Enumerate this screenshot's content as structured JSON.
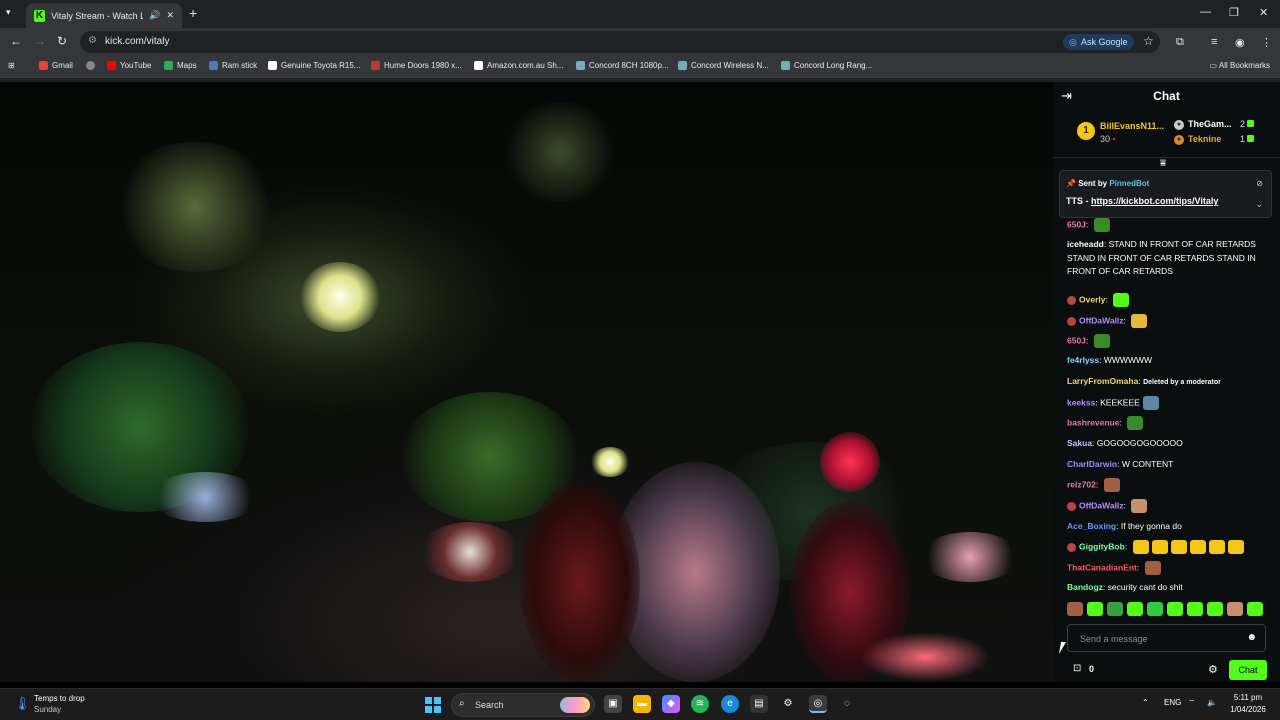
{
  "browser": {
    "tab_title": "Vitaly Stream - Watch Live",
    "url": "kick.com/vitaly",
    "ask_google": "Ask Google",
    "bookmarks": [
      "Gmail",
      "YouTube",
      "Maps",
      "Ram stick",
      "Genuine Toyota R15...",
      "Hume Doors 1980 x...",
      "Amazon.com.au Sh...",
      "Concord 8CH 1080p...",
      "Concord Wireless N...",
      "Concord Long Rang..."
    ],
    "all_bookmarks": "All Bookmarks"
  },
  "chat": {
    "title": "Chat",
    "leaderboard": {
      "first": {
        "rank": "1",
        "user": "BillEvansN11...",
        "count": "30"
      },
      "second": {
        "user": "TheGam...",
        "count": "2"
      },
      "third": {
        "user": "Teknine",
        "count": "1"
      }
    },
    "pinned": {
      "sent_by": "Sent by",
      "bot": "PinnedBot",
      "tts_prefix": "TTS - ",
      "tts_link": "https://kickbot.com/tips/Vitaly"
    },
    "messages": [
      {
        "user": "650J",
        "text": "",
        "color": "#e77aa8",
        "emote": "#3a8a2a"
      },
      {
        "user": "iceheadd",
        "text": "STAND IN FRONT OF CAR RETARDS STAND IN FRONT OF CAR RETARDS STAND IN FRONT OF CAR RETARDS",
        "color": "#ffffff"
      },
      {
        "user": "Overly",
        "text": "",
        "color": "#f5d76e",
        "emote": "#53fc18",
        "badge": true
      },
      {
        "user": "OffDaWallz",
        "text": "",
        "color": "#b58cff",
        "emote": "#e5b93a",
        "badge": true
      },
      {
        "user": "650J",
        "text": "",
        "color": "#e77aa8",
        "emote": "#3a8a2a"
      },
      {
        "user": "fe4rlyss",
        "text": "WWWWWW",
        "color": "#8fd3ff"
      },
      {
        "user": "LarryFromOmaha",
        "text": "Deleted by a moderator",
        "color": "#f5d76e",
        "deleted": true
      },
      {
        "user": "keekss",
        "text": "KEEKEEE",
        "color": "#b58cff",
        "emote": "#5a8aa0"
      },
      {
        "user": "bashrevenue",
        "text": "",
        "color": "#e77aa8",
        "emote": "#3a8a2a"
      },
      {
        "user": "Sakua",
        "text": "GOGOOGOGOOOOO",
        "color": "#c9c0ff"
      },
      {
        "user": "CharlDarwin",
        "text": "W CONTENT",
        "color": "#9f8cff"
      },
      {
        "user": "relz702",
        "text": "",
        "color": "#e77aa8",
        "emote": "#a0604a"
      },
      {
        "user": "OffDaWallz",
        "text": "",
        "color": "#b58cff",
        "emote": "#c49070",
        "badge": true
      },
      {
        "user": "Ace_Boxing",
        "text": "If they gonna do",
        "color": "#58a0ff"
      },
      {
        "user": "GiggityBob",
        "text": "",
        "color": "#7dffa0",
        "emote": "#f5c518",
        "badge": true,
        "repeat": 6
      },
      {
        "user": "ThatCanadianEnt",
        "text": "",
        "color": "#ff5a5a",
        "emote": "#a06040"
      },
      {
        "user": "Bandogz",
        "text": "security cant do shit",
        "color": "#7dffa0"
      }
    ],
    "emote_bar": [
      "#a0604a",
      "#53fc18",
      "#3aa03a",
      "#53fc18",
      "#2ecc40",
      "#53fc18",
      "#53fc18",
      "#53fc18",
      "#c49070",
      "#53fc18"
    ],
    "input_placeholder": "Send a message",
    "count": "0",
    "send_label": "Chat"
  },
  "taskbar": {
    "weather_title": "Temps to drop",
    "weather_sub": "Sunday",
    "search": "Search",
    "lang": "ENG",
    "time": "5:11 pm",
    "date": "1/04/2026"
  }
}
